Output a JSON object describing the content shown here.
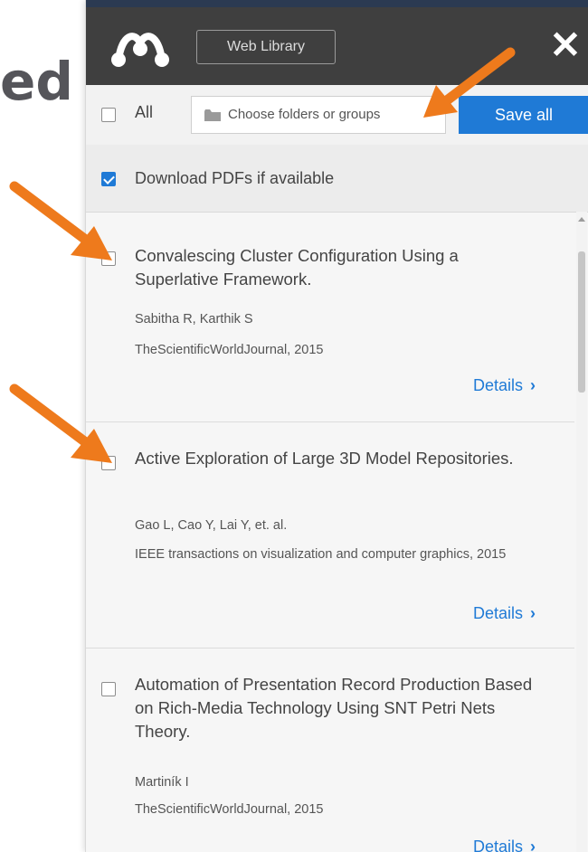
{
  "background": {
    "partial_text": "ed"
  },
  "header": {
    "logo_icon": "mendeley-logo-icon",
    "web_library_label": "Web Library",
    "close_label": "✕"
  },
  "select_bar": {
    "all_label": "All",
    "all_checked": false,
    "folder_placeholder": "Choose folders or groups",
    "save_all_label": "Save all"
  },
  "download": {
    "label": "Download PDFs if available",
    "checked": true
  },
  "results": [
    {
      "title": "Convalescing Cluster Configuration Using a Superlative Framework.",
      "authors": "Sabitha R,  Karthik S",
      "journal": "TheScientificWorldJournal, 2015",
      "details_label": "Details",
      "checked": false
    },
    {
      "title": "Active Exploration of Large 3D Model Repositories.",
      "authors": "Gao L,  Cao Y,  Lai Y,  et. al.",
      "journal": "IEEE transactions on visualization and computer graphics, 2015",
      "details_label": "Details",
      "checked": false
    },
    {
      "title": "Automation of Presentation Record Production Based on Rich-Media Technology Using SNT Petri Nets Theory.",
      "authors": "Martiník I",
      "journal": "TheScientificWorldJournal, 2015",
      "details_label": "Details",
      "checked": false
    }
  ],
  "colors": {
    "accent": "#1f7ad6",
    "header_bg": "#3f3f3f",
    "arrow": "#ee7a1c"
  }
}
